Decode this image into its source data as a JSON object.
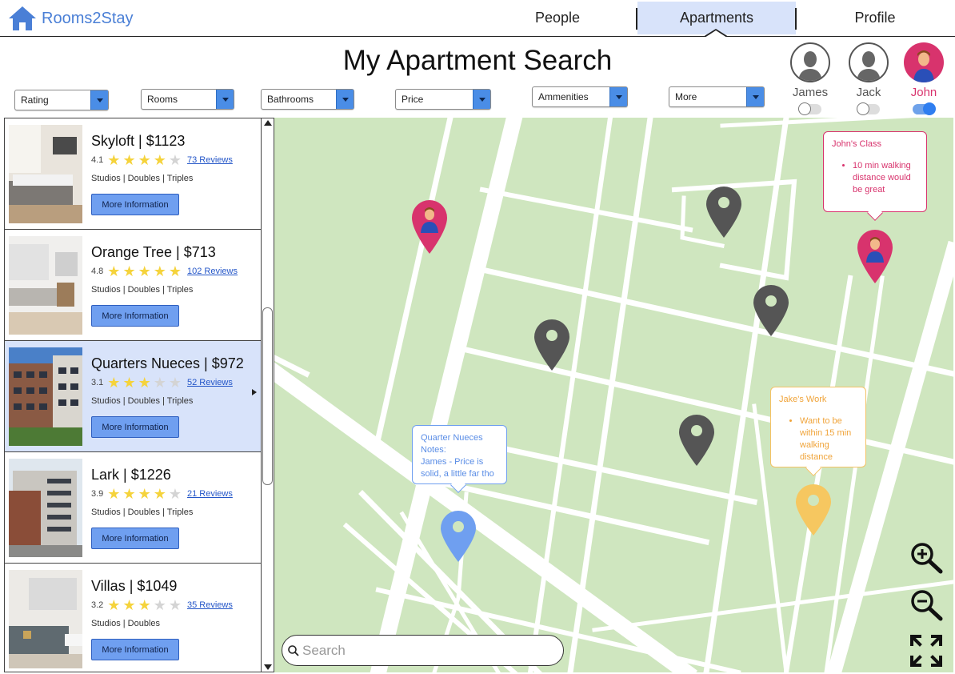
{
  "brand": {
    "name": "Rooms2Stay",
    "icon": "home-icon",
    "color": "#4a7fd6"
  },
  "nav": {
    "tabs": [
      {
        "label": "People"
      },
      {
        "label": "Apartments"
      },
      {
        "label": "Profile"
      }
    ],
    "active": "Apartments"
  },
  "page_title": "My Apartment Search",
  "filters": [
    {
      "label": "Rating"
    },
    {
      "label": "Rooms"
    },
    {
      "label": "Bathrooms"
    },
    {
      "label": "Price"
    },
    {
      "label": "Ammenities"
    },
    {
      "label": "More"
    }
  ],
  "users": [
    {
      "name": "James",
      "toggle": false
    },
    {
      "name": "Jack",
      "toggle": false
    },
    {
      "name": "John",
      "toggle": true
    }
  ],
  "listings": [
    {
      "title": "Skyloft | $1123",
      "rating": "4.1",
      "stars": 4,
      "reviews": "73 Reviews",
      "types": "Studios | Doubles | Triples",
      "button": "More Information"
    },
    {
      "title": "Orange Tree | $713",
      "rating": "4.8",
      "stars": 5,
      "reviews": "102 Reviews",
      "types": "Studios | Doubles | Triples",
      "button": "More Information"
    },
    {
      "title": "Quarters Nueces | $972",
      "rating": "3.1",
      "stars": 3,
      "reviews": "52 Reviews",
      "types": "Studios | Doubles | Triples",
      "button": "More Information",
      "selected": true
    },
    {
      "title": "Lark | $1226",
      "rating": "3.9",
      "stars": 4,
      "reviews": "21 Reviews",
      "types": "Studios | Doubles | Triples",
      "button": "More Information"
    },
    {
      "title": "Villas | $1049",
      "rating": "3.2",
      "stars": 3,
      "reviews": "35 Reviews",
      "types": "Studios | Doubles",
      "button": "More Information"
    }
  ],
  "map": {
    "notes": {
      "john": {
        "title": "John's Class",
        "items": [
          "10 min walking distance would be great"
        ],
        "color": "#d8336d"
      },
      "jake": {
        "title": "Jake's Work",
        "items": [
          "Want to be within 15 min walking distance"
        ],
        "color": "#f0a43a"
      },
      "quarters": {
        "title": "Quarter Nueces Notes:",
        "text": "James - Price is solid, a little far tho",
        "color": "#5a8de6"
      }
    },
    "search_placeholder": "Search",
    "controls": [
      "zoom-in-icon",
      "zoom-out-icon",
      "fullscreen-icon"
    ]
  },
  "colors": {
    "map_bg": "#cfe6bf",
    "selected_row": "#d8e3fa",
    "accent": "#6f9ff0",
    "pin_grey": "#555555"
  }
}
